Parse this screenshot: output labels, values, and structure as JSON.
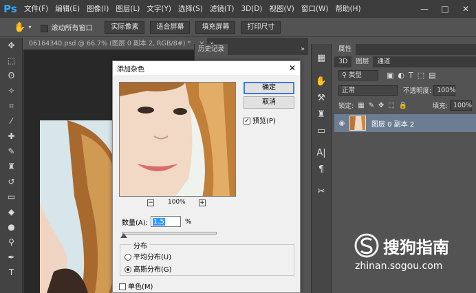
{
  "app": {
    "logo": "Ps",
    "menu": [
      "文件(F)",
      "编辑(E)",
      "图像(I)",
      "图层(L)",
      "文字(Y)",
      "选择(S)",
      "滤镜(T)",
      "3D(D)",
      "视图(V)",
      "窗口(W)",
      "帮助(H)"
    ]
  },
  "window_controls": {
    "minimize": "—",
    "maximize": "□",
    "close": "✕"
  },
  "options_bar": {
    "scroll_all_label": "滚动所有窗口",
    "buttons": [
      "实际像素",
      "适合屏幕",
      "填充屏幕",
      "打印尺寸"
    ]
  },
  "document": {
    "tab_label": "06164340.psd @ 66.7% (图层 0 副本 2, RGB/8#) *",
    "tab_close": "×",
    "tab_more": "»"
  },
  "history_panel": {
    "title": "历史记录",
    "more": "»"
  },
  "properties_panel": {
    "tabs": [
      "3D",
      "图层",
      "通道"
    ],
    "title": "属性",
    "filter_kind": "类型",
    "blend_mode": "正常",
    "opacity_label": "不透明度:",
    "opacity_value": "100%",
    "lock_label": "锁定:",
    "fill_label": "填充:",
    "fill_value": "100%",
    "layer_name": "图层 0 副本 2"
  },
  "dialog": {
    "title": "添加杂色",
    "ok_label": "确定",
    "cancel_label": "取消",
    "preview_label": "预览(P)",
    "preview_checked": true,
    "zoom_value": "100%",
    "zoom_minus": "−",
    "zoom_plus": "+",
    "amount_label": "数量(A):",
    "amount_value": "1.5",
    "amount_unit": "%",
    "distribution_label": "分布",
    "dist_uniform": "平均分布(U)",
    "dist_gaussian": "高斯分布(G)",
    "monochrome_label": "单色(M)"
  },
  "watermark": {
    "text": "搜狗指南",
    "url": "zhinan.sogou.com"
  }
}
